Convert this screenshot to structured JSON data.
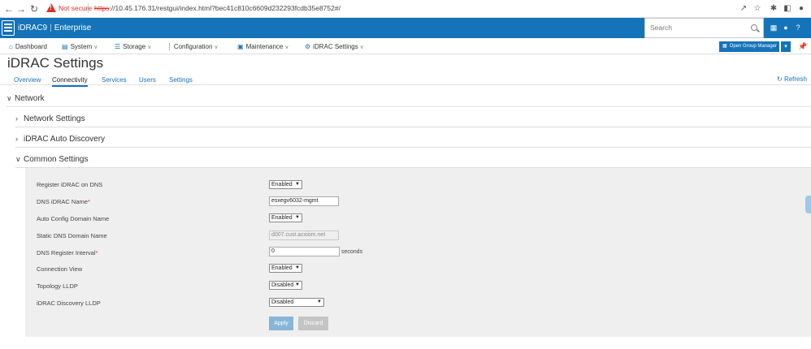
{
  "browser": {
    "back_icon": "arrow-left",
    "forward_icon": "arrow-right",
    "reload_icon": "reload",
    "security_label": "Not secure",
    "url_scheme": "https",
    "url_rest": "://10.45.176.31/restgui/index.html?bec41c810c6609d232293fcdb35e8752#/"
  },
  "header": {
    "app_name": "iDRAC9",
    "edition": "Enterprise",
    "search_placeholder": "Search",
    "brand_color": "#1473b9"
  },
  "menu": {
    "items": [
      {
        "label": "Dashboard",
        "icon": "home-icon"
      },
      {
        "label": "System",
        "icon": "server-icon"
      },
      {
        "label": "Storage",
        "icon": "storage-icon"
      },
      {
        "label": "Configuration",
        "icon": "sliders-icon"
      },
      {
        "label": "Maintenance",
        "icon": "maintenance-icon"
      },
      {
        "label": "iDRAC Settings",
        "icon": "idrac-icon"
      }
    ],
    "open_group_manager": "Open Group Manager"
  },
  "page": {
    "title": "iDRAC Settings",
    "tabs": [
      "Overview",
      "Connectivity",
      "Services",
      "Users",
      "Settings"
    ],
    "active_tab": "Connectivity",
    "refresh": "Refresh"
  },
  "sections": {
    "network": "Network",
    "network_settings": "Network Settings",
    "auto_discovery": "iDRAC Auto Discovery",
    "common_settings": "Common Settings"
  },
  "form": {
    "register_dns": {
      "label": "Register iDRAC on DNS",
      "value": "Enabled"
    },
    "dns_name": {
      "label": "DNS iDRAC Name",
      "value": "esxegv6032-mgmt"
    },
    "auto_domain": {
      "label": "Auto Config Domain Name",
      "value": "Enabled"
    },
    "static_domain": {
      "label": "Static DNS Domain Name",
      "value": "d007.cust.acxiom.net"
    },
    "register_interval": {
      "label": "DNS Register Interval",
      "value": "0",
      "unit": "seconds"
    },
    "connection_view": {
      "label": "Connection View",
      "value": "Enabled"
    },
    "topology_lldp": {
      "label": "Topology LLDP",
      "value": "Disabled"
    },
    "discovery_lldp": {
      "label": "iDRAC Discovery LLDP",
      "value": "Disabled"
    },
    "required_mark": "*",
    "apply": "Apply",
    "discard": "Discard"
  }
}
